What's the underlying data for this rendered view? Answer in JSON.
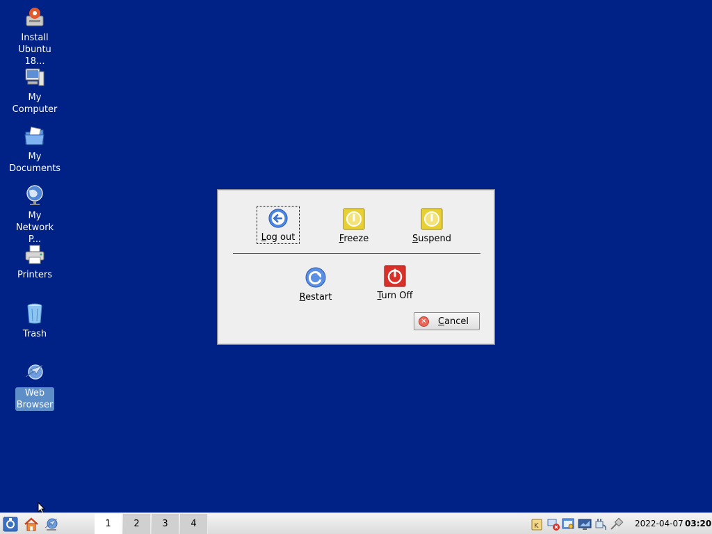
{
  "desktop_icons": [
    {
      "label": "Install\nUbuntu 18...",
      "icon": "install-ubuntu-icon"
    },
    {
      "label": "My\nComputer",
      "icon": "computer-icon"
    },
    {
      "label": "My\nDocuments",
      "icon": "documents-folder-icon"
    },
    {
      "label": "My\nNetwork P...",
      "icon": "network-globe-icon"
    },
    {
      "label": "Printers",
      "icon": "printer-icon"
    },
    {
      "label": "Trash",
      "icon": "trash-icon"
    },
    {
      "label": "Web\nBrowser",
      "icon": "web-browser-icon"
    }
  ],
  "dialog": {
    "options": {
      "logout": {
        "label": "Log out",
        "icon": "logout-arrow-icon"
      },
      "freeze": {
        "label": "Freeze",
        "icon": "freeze-power-icon"
      },
      "suspend": {
        "label": "Suspend",
        "icon": "suspend-power-icon"
      },
      "restart": {
        "label": "Restart",
        "icon": "restart-icon"
      },
      "turnoff": {
        "label": "Turn Off",
        "icon": "turn-off-power-icon"
      }
    },
    "cancel_label": "Cancel"
  },
  "taskbar": {
    "desktops": [
      "1",
      "2",
      "3",
      "4"
    ],
    "active_desktop": "1",
    "date": "2022-04-07",
    "time": "03:20"
  },
  "colors": {
    "desktop_bg": "#002185",
    "dialog_bg": "#efefef",
    "selected_label": "#5e8ec7"
  }
}
